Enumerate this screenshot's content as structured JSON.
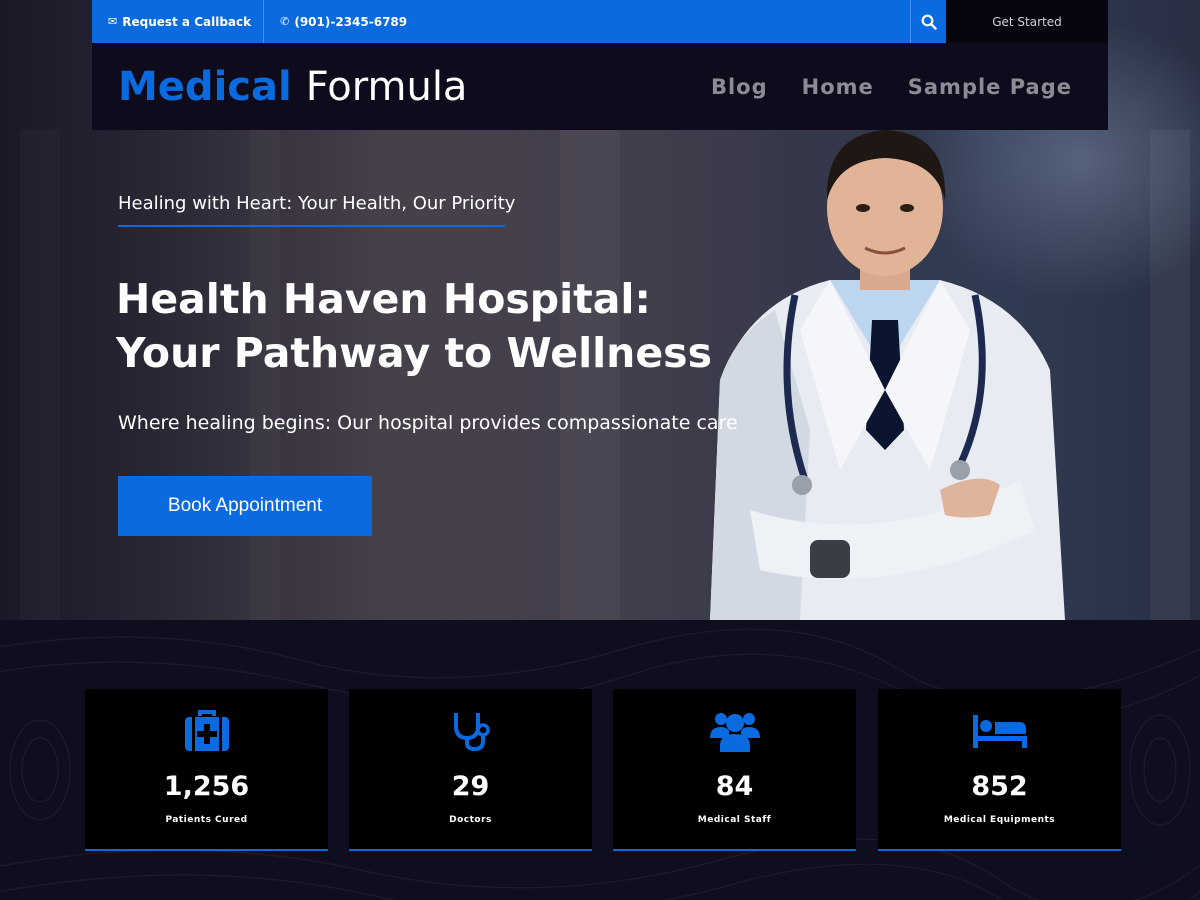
{
  "topbar": {
    "callback_label": "Request a Callback",
    "phone": "(901)-2345-6789",
    "get_started_label": "Get Started"
  },
  "header": {
    "logo_part1": "Medical",
    "logo_part2": "Formula",
    "nav": [
      "Blog",
      "Home",
      "Sample Page"
    ]
  },
  "hero": {
    "tagline": "Healing with Heart: Your Health, Our Priority",
    "headline": "Health Haven Hospital: Your Pathway to Wellness",
    "subline": "Where healing begins: Our hospital provides compassionate care",
    "cta_label": "Book Appointment"
  },
  "stats": [
    {
      "icon": "medical-kit-icon",
      "value": "1,256",
      "label": "Patients Cured"
    },
    {
      "icon": "stethoscope-icon",
      "value": "29",
      "label": "Doctors"
    },
    {
      "icon": "users-icon",
      "value": "84",
      "label": "Medical Staff"
    },
    {
      "icon": "bed-icon",
      "value": "852",
      "label": "Medical Equipments"
    }
  ],
  "colors": {
    "accent": "#0a6adf",
    "dark": "#0e0c1c",
    "card": "#000000"
  }
}
